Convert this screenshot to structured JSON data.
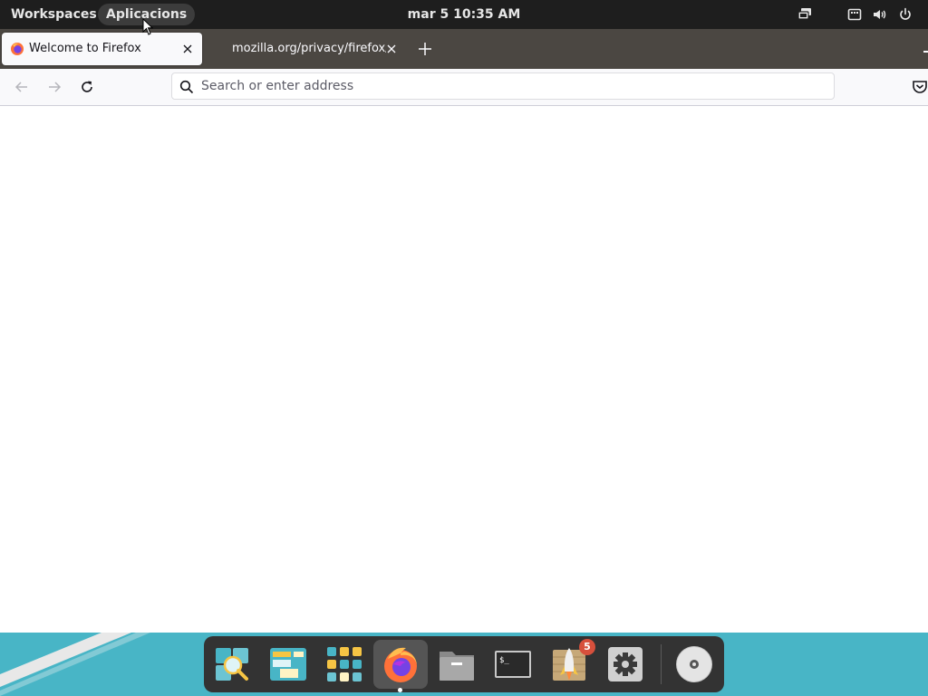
{
  "top_panel": {
    "workspaces_label": "Workspaces",
    "apps_label": "Aplicacions",
    "clock": "mar 5  10:35 AM",
    "tray_icons": [
      "screen-share-icon",
      "keyboard-icon",
      "volume-icon",
      "power-icon"
    ]
  },
  "browser": {
    "tabs": [
      {
        "title": "Welcome to Firefox",
        "favicon": "firefox-icon",
        "active": true
      },
      {
        "title": "mozilla.org/privacy/firefox/",
        "active": false
      }
    ],
    "url_placeholder": "Search or enter address",
    "nav_icons": [
      "back-arrow-icon",
      "forward-arrow-icon",
      "reload-icon",
      "pocket-icon"
    ]
  },
  "dock": {
    "items": [
      {
        "name": "Search"
      },
      {
        "name": "Workspaces"
      },
      {
        "name": "Applications"
      },
      {
        "name": "Firefox",
        "running": true
      },
      {
        "name": "Files"
      },
      {
        "name": "Terminal"
      },
      {
        "name": "Popsicle",
        "badge": "5"
      },
      {
        "name": "Settings"
      },
      {
        "name": "Disc"
      }
    ]
  },
  "colors": {
    "panel_bg": "#1e1e1e",
    "tab_strip_bg": "#4b4742",
    "desktop_teal": "#48b5c6",
    "dock_bg": "#333333",
    "badge_red": "#d7503c"
  }
}
